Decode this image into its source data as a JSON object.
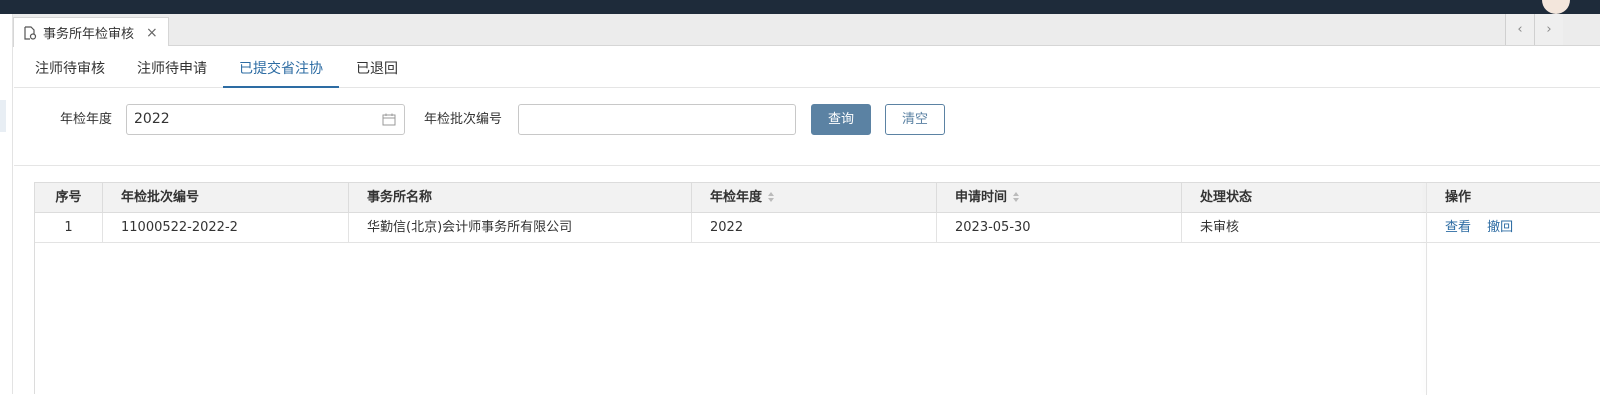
{
  "page_tab": {
    "title": "事务所年检审核",
    "close": "×"
  },
  "tab_nav": {
    "prev": "‹",
    "next": "›"
  },
  "subtabs": [
    {
      "label": "注师待审核",
      "active": false
    },
    {
      "label": "注师待申请",
      "active": false
    },
    {
      "label": "已提交省注协",
      "active": true
    },
    {
      "label": "已退回",
      "active": false
    }
  ],
  "filter": {
    "year_label": "年检年度",
    "year_value": "2022",
    "batch_label": "年检批次编号",
    "batch_value": "",
    "query_button": "查询",
    "clear_button": "清空"
  },
  "table": {
    "columns": [
      "序号",
      "年检批次编号",
      "事务所名称",
      "年检年度",
      "申请时间",
      "处理状态",
      "操作"
    ],
    "rows": [
      {
        "index": "1",
        "batch_no": "11000522-2022-2",
        "firm_name": "华勤信(北京)会计师事务所有限公司",
        "year": "2022",
        "apply_time": "2023-05-30",
        "status": "未审核",
        "actions": [
          "查看",
          "撤回"
        ]
      }
    ]
  },
  "colors": {
    "accent": "#2d6ca3",
    "button": "#5b82a3",
    "topbar": "#1e2b3a"
  }
}
